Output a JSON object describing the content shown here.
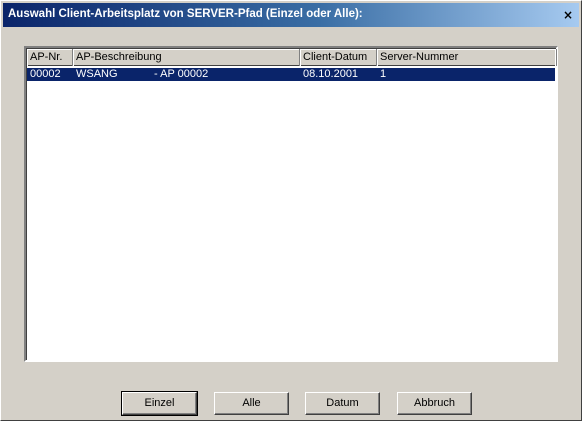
{
  "window": {
    "title": "Auswahl Client-Arbeitsplatz von SERVER-Pfad (Einzel oder Alle):",
    "close_glyph": "×"
  },
  "table": {
    "columns": [
      "AP-Nr.",
      "AP-Beschreibung",
      "Client-Datum",
      "Server-Nummer"
    ],
    "rows": [
      {
        "ap_nr": "00002",
        "beschreibung": "WSANG",
        "ap_label": "- AP 00002",
        "datum": "08.10.2001",
        "server_nr": "1",
        "selected": true
      }
    ]
  },
  "buttons": {
    "einzel": "Einzel",
    "alle": "Alle",
    "datum": "Datum",
    "abbruch": "Abbruch"
  }
}
